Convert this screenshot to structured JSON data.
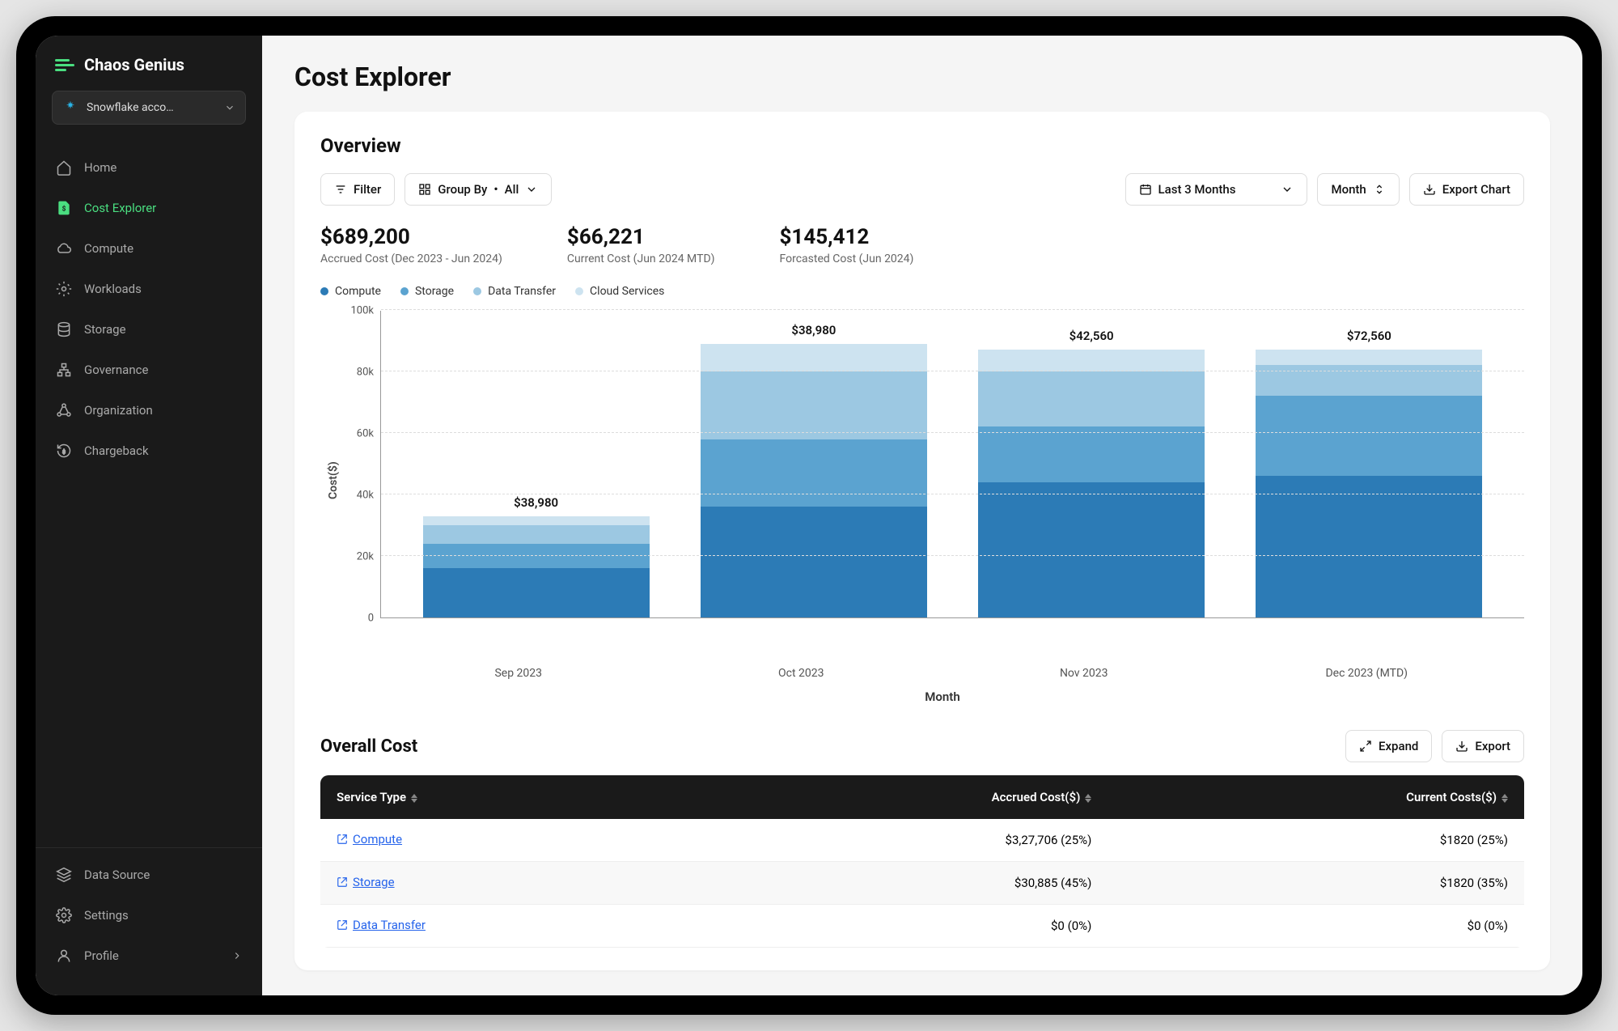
{
  "brand": {
    "name": "Chaos Genius"
  },
  "account_selector": {
    "label": "Snowflake acco…"
  },
  "sidebar": {
    "items": [
      {
        "label": "Home",
        "active": false
      },
      {
        "label": "Cost Explorer",
        "active": true
      },
      {
        "label": "Compute",
        "active": false
      },
      {
        "label": "Workloads",
        "active": false
      },
      {
        "label": "Storage",
        "active": false
      },
      {
        "label": "Governance",
        "active": false
      },
      {
        "label": "Organization",
        "active": false
      },
      {
        "label": "Chargeback",
        "active": false
      }
    ],
    "bottom": [
      {
        "label": "Data Source"
      },
      {
        "label": "Settings"
      },
      {
        "label": "Profile"
      }
    ]
  },
  "page": {
    "title": "Cost Explorer"
  },
  "overview": {
    "title": "Overview",
    "filter_label": "Filter",
    "groupby_label": "Group By",
    "groupby_value": "All",
    "date_range": "Last 3 Months",
    "granularity": "Month",
    "export_label": "Export Chart",
    "stats": [
      {
        "value": "$689,200",
        "label": "Accrued Cost (Dec 2023 - Jun 2024)"
      },
      {
        "value": "$66,221",
        "label": "Current Cost (Jun 2024 MTD)"
      },
      {
        "value": "$145,412",
        "label": "Forcasted Cost (Jun 2024)"
      }
    ],
    "legend": [
      {
        "name": "Compute",
        "color": "#2c7bb6"
      },
      {
        "name": "Storage",
        "color": "#5ba3d0"
      },
      {
        "name": "Data Transfer",
        "color": "#9cc8e2"
      },
      {
        "name": "Cloud Services",
        "color": "#cde3f0"
      }
    ]
  },
  "chart_data": {
    "type": "bar_stacked",
    "title": "",
    "xlabel": "Month",
    "ylabel": "Cost($)",
    "ylim": [
      0,
      100000
    ],
    "yticks": [
      "0",
      "20k",
      "40k",
      "60k",
      "80k",
      "100k"
    ],
    "categories": [
      "Sep 2023",
      "Oct 2023",
      "Nov 2023",
      "Dec 2023 (MTD)"
    ],
    "series": [
      {
        "name": "Compute",
        "color": "#2c7bb6",
        "values": [
          16000,
          36000,
          44000,
          46000
        ]
      },
      {
        "name": "Storage",
        "color": "#5ba3d0",
        "values": [
          8000,
          22000,
          18000,
          26000
        ]
      },
      {
        "name": "Data Transfer",
        "color": "#9cc8e2",
        "values": [
          6000,
          22000,
          18000,
          10000
        ]
      },
      {
        "name": "Cloud Services",
        "color": "#cde3f0",
        "values": [
          3000,
          9000,
          7000,
          5000
        ]
      }
    ],
    "bar_labels": [
      "$38,980",
      "$38,980",
      "$42,560",
      "$72,560"
    ]
  },
  "overall_cost": {
    "title": "Overall Cost",
    "expand_label": "Expand",
    "export_label": "Export",
    "columns": [
      "Service Type",
      "Accrued Cost($)",
      "Current Costs($)"
    ],
    "rows": [
      {
        "service": "Compute",
        "accrued": "$3,27,706 (25%)",
        "current": "$1820 (25%)"
      },
      {
        "service": "Storage",
        "accrued": "$30,885 (45%)",
        "current": "$1820 (35%)"
      },
      {
        "service": "Data Transfer",
        "accrued": "$0 (0%)",
        "current": "$0 (0%)"
      }
    ]
  }
}
